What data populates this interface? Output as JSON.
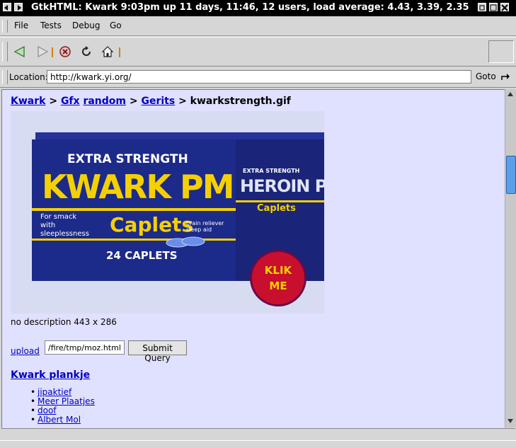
{
  "window": {
    "title": "GtkHTML: Kwark 9:03pm up 11 days, 11:46, 12 users, load average: 4.43, 3.39, 2.35"
  },
  "menu": {
    "items": [
      {
        "label": "File"
      },
      {
        "label": "Tests"
      },
      {
        "label": "Debug"
      },
      {
        "label": "Go"
      }
    ]
  },
  "location": {
    "label": "Location:",
    "url": "http://kwark.yi.org/",
    "goto_label": "Goto"
  },
  "breadcrumb": {
    "kwark": "Kwark",
    "sep1": ">",
    "gfx": "Gfx",
    "random": "random",
    "sep2": ">",
    "gerits": "Gerits",
    "sep3": ">",
    "current": "kwarkstrength.gif"
  },
  "image": {
    "headline_top": "EXTRA STRENGTH",
    "brand": "KWARK PM",
    "tagline": "For smack with sleeplessness",
    "product": "Caplets",
    "count": "24 CAPLETS",
    "side_top": "EXTRA STRENGTH",
    "side_brand": "HEROIN PM",
    "side_product": "Caplets",
    "small_text": "brain reliever sleep aid",
    "badge": "KLIK ME"
  },
  "description": "no description 443 x 286",
  "upload": {
    "link": "upload",
    "file_value": "/fire/tmp/moz.html",
    "submit_label": "Submit Query"
  },
  "section": {
    "title": "Kwark plankje",
    "links": [
      "jipaktief",
      "Meer Plaatjes",
      "doof",
      "Albert Mol"
    ]
  },
  "colors": {
    "page_bg": "#e0e0ff",
    "link": "#0000c0",
    "box_blue": "#1c2a8a",
    "brand_yellow": "#f5d000",
    "badge_red": "#c8102e"
  }
}
